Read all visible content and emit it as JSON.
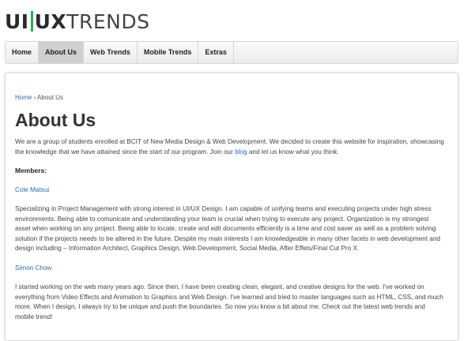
{
  "logo": {
    "ui": "UI",
    "ux": "UX",
    "trends": "TRENDS"
  },
  "nav": {
    "items": [
      {
        "label": "Home"
      },
      {
        "label": "About Us"
      },
      {
        "label": "Web Trends"
      },
      {
        "label": "Mobile Trends"
      },
      {
        "label": "Extras"
      }
    ],
    "active": "About Us"
  },
  "breadcrumb": {
    "home": "Home",
    "separator": "›",
    "current": "About Us"
  },
  "page": {
    "title": "About Us",
    "intro_before_link": "We are a group of students enrolled at BCIT of New Media Design & Web Development. We decided to create this website for inspiration, showcasing the knowledge that we have attained since the start of our program. Join our ",
    "intro_link": "blog",
    "intro_after_link": " and let us know what you think.",
    "members_heading": "Members:",
    "members": [
      {
        "name": "Cole Matsui",
        "bio": "Specializing in Project Management with strong interest in UI/UX Design. I am capable of unifying teams and executing projects under high stress environments. Being able to comunicate and understanding your team is crucial when trying to execute any project. Organization is my strongest asset when working on any project. Being able to locate, create and edit documents efficiently is a time and cost saver as well as a problem solving solution if the projects needs to be altered in the future. Despite my main interests I am knowledgeable in many other facets in web development and design including – Information Architect, Graphics Design, Web Development, Social Media, After Effets/Final Cut Pro X."
      },
      {
        "name": "Simon Chow",
        "bio": "I started working on the web many years ago. Since then, I have been creating clean, elegant, and creative designs for the web. I've worked on everything from Video Effects and Animation to Graphics and Web Design. I've learned and tried to master languages such as HTML, CSS, and much more. When I design, I always try to be unique and push the boundaries. So now you know a bit about me. Check out the latest web trends and mobile trend!"
      }
    ]
  },
  "colors": {
    "accent_bar": "#21b04b",
    "link": "#2a6bb3",
    "active_tab": "#cfcfcf"
  }
}
